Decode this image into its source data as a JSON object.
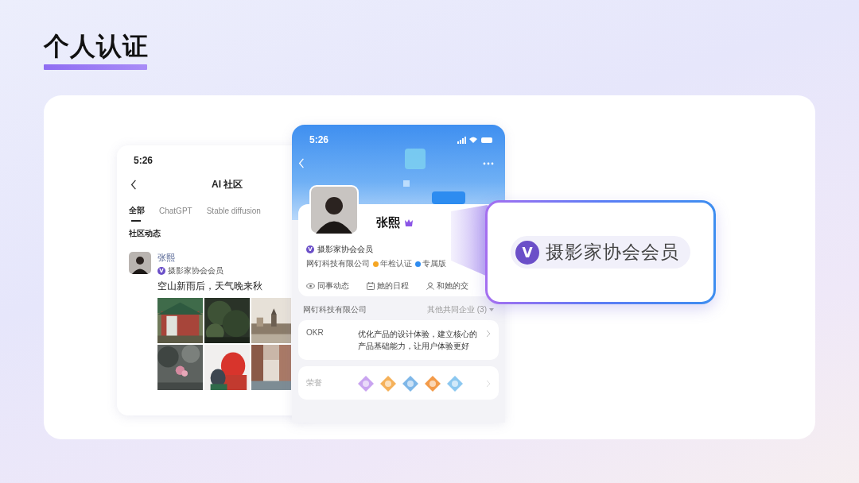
{
  "title": "个人认证",
  "feed_screen": {
    "time": "5:26",
    "header": "AI 社区",
    "tabs": [
      {
        "label": "全部",
        "selected": true
      },
      {
        "label": "ChatGPT",
        "selected": false
      },
      {
        "label": "Stable diffusion",
        "selected": false
      }
    ],
    "section": "社区动态",
    "post": {
      "author": "张熙",
      "badge_mark": "V",
      "badge": "摄影家协会会员",
      "text": "空山新雨后，天气晚来秋"
    }
  },
  "profile_screen": {
    "time": "5:26",
    "name": "张熙",
    "badge_mark": "V",
    "badge": "摄影家协会会员",
    "company": "网钉科技有限公司",
    "tags": [
      {
        "label": "年检认证",
        "color": "#f5a623"
      },
      {
        "label": "专属版",
        "color": "#2f8cf0"
      }
    ],
    "actions": [
      {
        "label": "同事动态",
        "kind": "eye"
      },
      {
        "label": "她的日程",
        "kind": "calendar"
      },
      {
        "label": "和她的交",
        "kind": "person"
      }
    ],
    "org": "网钉科技有限公司",
    "org_switch": {
      "label": "其他共同企业 (3)",
      "expanded": false
    },
    "okr_label": "OKR",
    "okr_text": "优化产品的设计体验，建立核心的产品基础能力，让用户体验更好",
    "honor_label": "荣誉",
    "honors": [
      {
        "color": "#c9a4f0"
      },
      {
        "color": "#f5b15a"
      },
      {
        "color": "#7fb7e8"
      },
      {
        "color": "#f39b4a"
      },
      {
        "color": "#8cc8f0"
      }
    ]
  },
  "callout": {
    "badge_mark": "V",
    "badge": "摄影家协会会员"
  }
}
